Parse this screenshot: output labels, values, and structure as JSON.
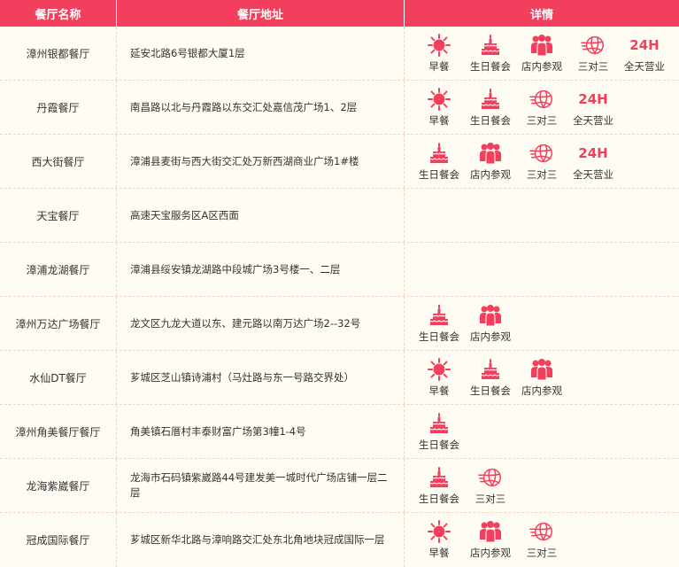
{
  "colors": {
    "accent": "#f23f5d",
    "background": "#fffdf3"
  },
  "header": {
    "name": "餐厅名称",
    "address": "餐厅地址",
    "details": "详情"
  },
  "services": {
    "breakfast": {
      "label": "早餐",
      "icon": "sun-icon"
    },
    "birthday": {
      "label": "生日餐会",
      "icon": "cake-icon"
    },
    "visit": {
      "label": "店内参观",
      "icon": "group-icon"
    },
    "basketball": {
      "label": "三对三",
      "icon": "basketball-icon"
    },
    "allday": {
      "label": "全天营业",
      "icon": "24h-icon",
      "text": "24H"
    }
  },
  "restaurants": [
    {
      "name": "漳州银都餐厅",
      "address": "延安北路6号银都大厦1层",
      "services": [
        "breakfast",
        "birthday",
        "visit",
        "basketball",
        "allday"
      ]
    },
    {
      "name": "丹霞餐厅",
      "address": "南昌路以北与丹霞路以东交汇处嘉信茂广场1、2层",
      "services": [
        "breakfast",
        "birthday",
        "basketball",
        "allday"
      ]
    },
    {
      "name": "西大街餐厅",
      "address": "漳浦县麦街与西大街交汇处万新西湖商业广场1#楼",
      "services": [
        "birthday",
        "visit",
        "basketball",
        "allday"
      ]
    },
    {
      "name": "天宝餐厅",
      "address": "高速天宝服务区A区西面",
      "services": []
    },
    {
      "name": "漳浦龙湖餐厅",
      "address": "漳浦县绥安镇龙湖路中段城广场3号楼一、二层",
      "services": []
    },
    {
      "name": "漳州万达广场餐厅",
      "address": "龙文区九龙大道以东、建元路以南万达广场2--32号",
      "services": [
        "birthday",
        "visit"
      ]
    },
    {
      "name": "水仙DT餐厅",
      "address": "芗城区芝山镇诗浦村（马灶路与东一号路交界处）",
      "services": [
        "breakfast",
        "birthday",
        "visit"
      ]
    },
    {
      "name": "漳州角美餐厅餐厅",
      "address": "角美镇石厝村丰泰财富广场第3幢1-4号",
      "services": [
        "birthday"
      ]
    },
    {
      "name": "龙海紫崴餐厅",
      "address": "龙海市石码镇紫崴路44号建发美一城时代广场店铺一层二层",
      "services": [
        "birthday",
        "basketball"
      ]
    },
    {
      "name": "冠成国际餐厅",
      "address": "芗城区新华北路与漳响路交汇处东北角地块冠成国际一层",
      "services": [
        "breakfast",
        "visit",
        "basketball"
      ]
    }
  ]
}
